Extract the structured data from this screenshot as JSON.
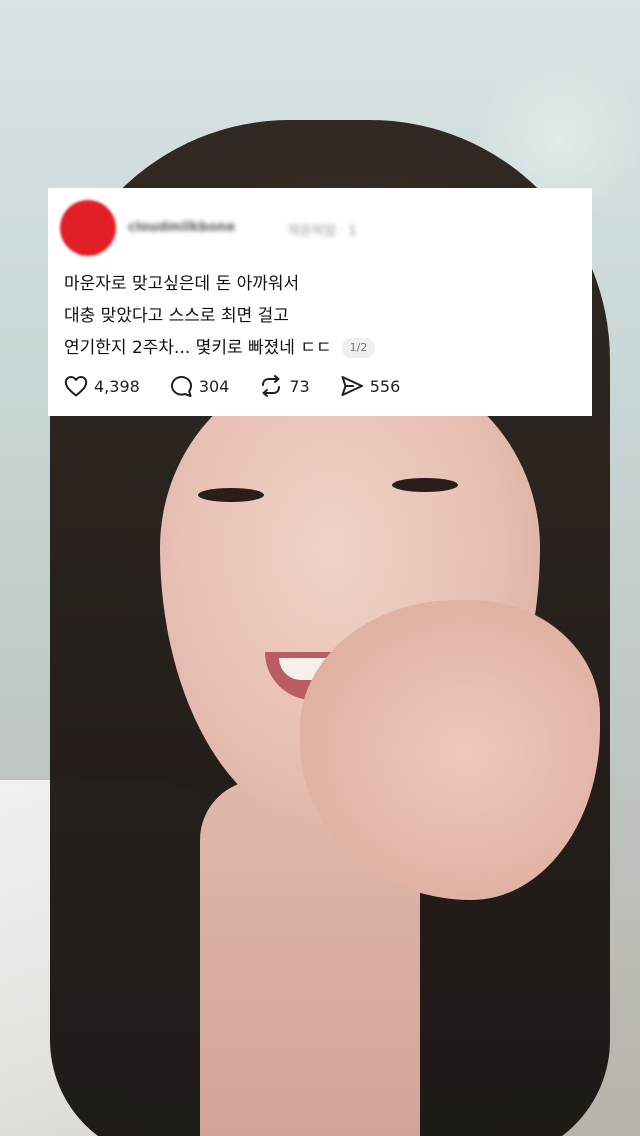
{
  "post": {
    "username": "cloudmilkbone",
    "meta": "작은작업 · 1",
    "lines": [
      "마운자로 맞고싶은데 돈 아까워서",
      "대충 맞았다고 스스로 최면 걸고",
      "연기한지 2주차... 몇키로 빠졌네 ㄷㄷ"
    ],
    "page_indicator": "1/2",
    "avatar_color": "#e01f26"
  },
  "actions": {
    "likes": "4,398",
    "comments": "304",
    "reposts": "73",
    "shares": "556"
  },
  "icons": {
    "like": "heart-icon",
    "comment": "comment-bubble-icon",
    "repost": "repost-icon",
    "share": "send-icon"
  }
}
